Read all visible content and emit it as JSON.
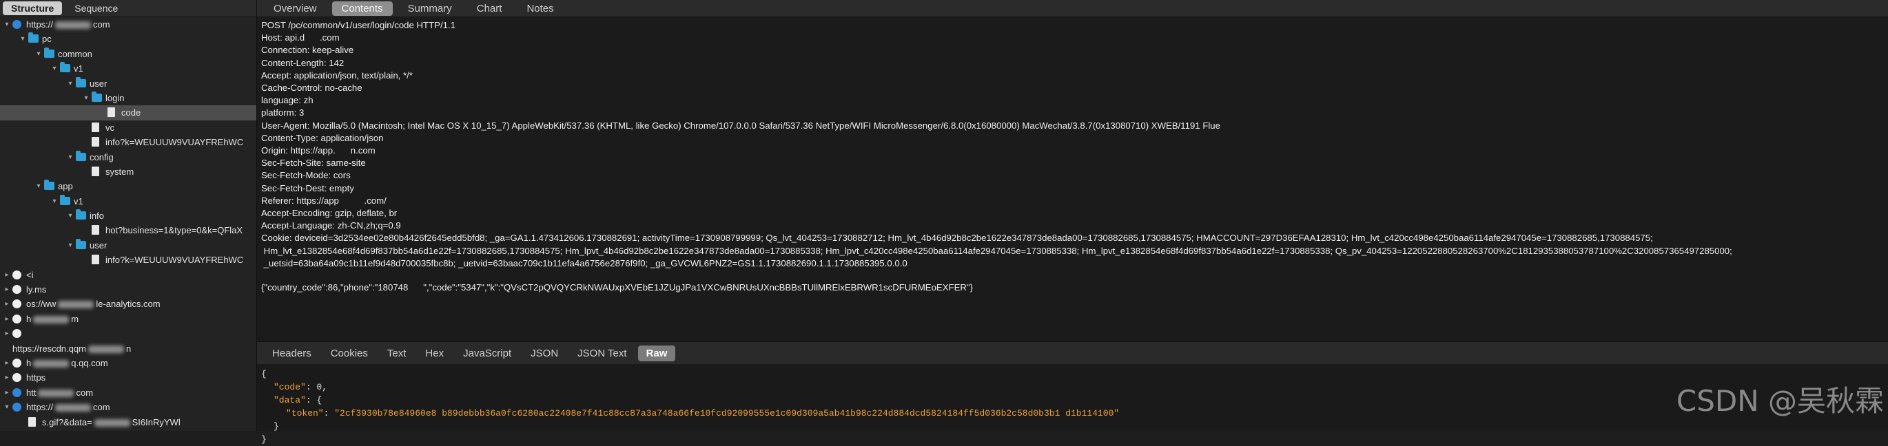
{
  "left_tabs": [
    "Structure",
    "Sequence"
  ],
  "right_tabs": [
    "Overview",
    "Contents",
    "Summary",
    "Chart",
    "Notes"
  ],
  "tree": [
    {
      "label": "https://",
      "label2": "com",
      "level": 0,
      "icon": "globe-blue",
      "arrow": "v"
    },
    {
      "label": "pc",
      "level": 1,
      "icon": "folder",
      "arrow": "v"
    },
    {
      "label": "common",
      "level": 2,
      "icon": "folder",
      "arrow": "v"
    },
    {
      "label": "v1",
      "level": 3,
      "icon": "folder",
      "arrow": "v"
    },
    {
      "label": "user",
      "level": 4,
      "icon": "folder",
      "arrow": "v"
    },
    {
      "label": "login",
      "level": 5,
      "icon": "folder",
      "arrow": "v"
    },
    {
      "label": "code",
      "level": 6,
      "icon": "file",
      "arrow": "",
      "selected": true
    },
    {
      "label": "vc",
      "level": 5,
      "icon": "file",
      "arrow": ""
    },
    {
      "label": "info?k=WEUUUW9VUAYFREhWC",
      "level": 5,
      "icon": "file",
      "arrow": ""
    },
    {
      "label": "config",
      "level": 4,
      "icon": "folder",
      "arrow": "v"
    },
    {
      "label": "system",
      "level": 5,
      "icon": "file",
      "arrow": ""
    },
    {
      "label": "app",
      "level": 2,
      "icon": "folder",
      "arrow": "v"
    },
    {
      "label": "v1",
      "level": 3,
      "icon": "folder",
      "arrow": "v"
    },
    {
      "label": "info",
      "level": 4,
      "icon": "folder",
      "arrow": "v"
    },
    {
      "label": "hot?business=1&type=0&k=QFlaX",
      "level": 5,
      "icon": "file",
      "arrow": ""
    },
    {
      "label": "user",
      "level": 4,
      "icon": "folder",
      "arrow": "v"
    },
    {
      "label": "info?k=WEUUUW9VUAYFREhWC",
      "level": 5,
      "icon": "file",
      "arrow": ""
    },
    {
      "label": "<i",
      "level": 0,
      "icon": "globe",
      "arrow": ">"
    },
    {
      "label": "ly.ms",
      "level": 0,
      "icon": "globe",
      "arrow": ">"
    },
    {
      "label": "os://ww",
      "label2": "le-analytics.com",
      "level": 0,
      "icon": "globe",
      "arrow": ">"
    },
    {
      "label": "h",
      "label2": "m",
      "level": 0,
      "icon": "globe",
      "arrow": ">"
    },
    {
      "label": "",
      "level": 0,
      "icon": "globe",
      "arrow": ">"
    },
    {
      "label": "https://rescdn.qqm",
      "label2": "n",
      "level": 0,
      "icon": "",
      "arrow": ""
    },
    {
      "label": "h",
      "label2": "q.qq.com",
      "level": 0,
      "icon": "globe",
      "arrow": ">"
    },
    {
      "label": "https",
      "level": 0,
      "icon": "globe",
      "arrow": ">"
    },
    {
      "label": "htt",
      "label2": "com",
      "level": 0,
      "icon": "globe-blue",
      "arrow": ">"
    },
    {
      "label": "https://",
      "label2": "com",
      "level": 0,
      "icon": "globe-blue",
      "arrow": "v"
    },
    {
      "label": "s.gif?&data=",
      "label2": "SI6InRyYWl",
      "level": 1,
      "icon": "file",
      "arrow": ""
    }
  ],
  "request_lines": [
    "POST /pc/common/v1/user/login/code HTTP/1.1",
    "Host: api.d      .com",
    "Connection: keep-alive",
    "Content-Length: 142",
    "Accept: application/json, text/plain, */*",
    "Cache-Control: no-cache",
    "language: zh",
    "platform: 3",
    "User-Agent: Mozilla/5.0 (Macintosh; Intel Mac OS X 10_15_7) AppleWebKit/537.36 (KHTML, like Gecko) Chrome/107.0.0.0 Safari/537.36 NetType/WIFI MicroMessenger/6.8.0(0x16080000) MacWechat/3.8.7(0x13080710) XWEB/1191 Flue",
    "Content-Type: application/json",
    "Origin: https://app.      n.com",
    "Sec-Fetch-Site: same-site",
    "Sec-Fetch-Mode: cors",
    "Sec-Fetch-Dest: empty",
    "Referer: https://app          .com/",
    "Accept-Encoding: gzip, deflate, br",
    "Accept-Language: zh-CN,zh;q=0.9",
    "Cookie: deviceid=3d2534ee02e80b4426f2645edd5bfd8; _ga=GA1.1.473412606.1730882691; activityTime=1730908799999; Qs_lvt_404253=1730882712; Hm_lvt_4b46d92b8c2be1622e347873de8ada00=1730882685,1730884575; HMACCOUNT=297D36EFAA128310; Hm_lvt_c420cc498e4250baa6114afe2947045e=1730882685,1730884575;",
    " Hm_lvt_e1382854e68f4d69f837bb54a6d1e22f=1730882685,1730884575; Hm_lpvt_4b46d92b8c2be1622e347873de8ada00=1730885338; Hm_lpvt_c420cc498e4250baa6114afe2947045e=1730885338; Hm_lpvt_e1382854e68f4d69f837bb54a6d1e22f=1730885338; Qs_pv_404253=1220522880528263700%2C1812935388053787100%2C3200857365497285000;",
    " _uetsid=63ba64a09c1b11ef9d48d700035fbc8b; _uetvid=63baac709c1b11efa4a6756e2876f9f0; _ga_GVCWL6PNZ2=GS1.1.1730882690.1.1.1730885395.0.0.0"
  ],
  "request_body": "{\"country_code\":86,\"phone\":\"180748      \",\"code\":\"5347\",\"k\":\"QVsCT2pQVQYCRkNWAUxpXVEbE1JZUgJPa1VXCwBNRUsUXncBBBsTUllMRElxEBRWR1scDFURMEoEXFER\"}",
  "sub_tabs": [
    "Headers",
    "Cookies",
    "Text",
    "Hex",
    "JavaScript",
    "JSON",
    "JSON Text",
    "Raw"
  ],
  "response": {
    "open": "{",
    "code_key": "\"code\"",
    "code_val": "0,",
    "data_key": "\"data\"",
    "data_open": "{",
    "token_key": "\"token\"",
    "token_val": "\"2cf3930b78e84960e8          b89debbb36a0fc6280ac22408e7f41c88cc87a3a748a66fe10fcd92099555e1c09d309a5ab41b98c224d884dcd5824184ff5d036b2c58d0b3b1          d1b114100\"",
    "data_close": "}",
    "close": "}"
  },
  "watermark": "CSDN @吴秋霖",
  "colors": {
    "accent_folder": "#2f9fd6",
    "json_string": "#f0a33a",
    "selected_row": "#4d4d4d"
  }
}
